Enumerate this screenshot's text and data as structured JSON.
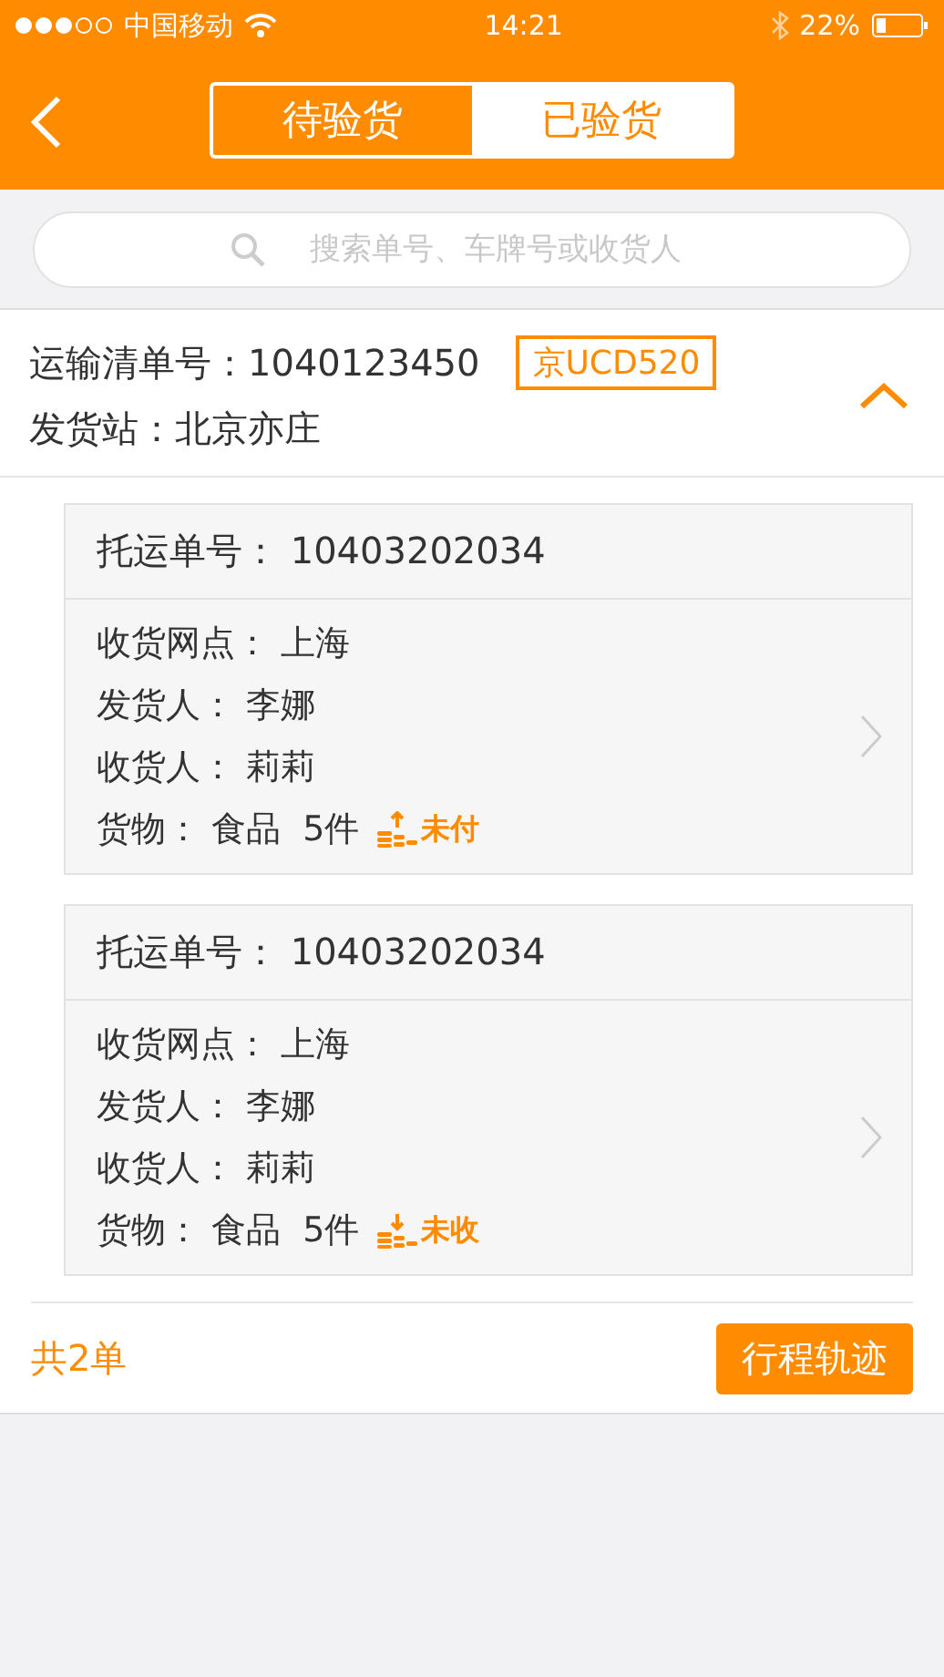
{
  "status_bar": {
    "carrier": "中国移动",
    "time": "14:21",
    "battery": "22%"
  },
  "tabs": [
    {
      "label": "待验货",
      "selected": false
    },
    {
      "label": "已验货",
      "selected": true
    }
  ],
  "search": {
    "placeholder": "搜索单号、车牌号或收货人"
  },
  "manifest": {
    "number_label": "运输清单号：",
    "number": "1040123450",
    "plate": "京UCD520",
    "station_label": "发货站：",
    "station": "北京亦庄",
    "expanded": true
  },
  "shipments": [
    {
      "title_label": "托运单号：",
      "title": "10403202034",
      "fields": [
        {
          "label": "收货网点：",
          "value": "上海"
        },
        {
          "label": "发货人：",
          "value": "李娜"
        },
        {
          "label": "收货人：",
          "value": "莉莉"
        }
      ],
      "goods_label": "货物：",
      "goods": "食品",
      "count": "5件",
      "payment": {
        "kind": "pay",
        "label": "未付"
      }
    },
    {
      "title_label": "托运单号：",
      "title": "10403202034",
      "fields": [
        {
          "label": "收货网点：",
          "value": "上海"
        },
        {
          "label": "发货人：",
          "value": "李娜"
        },
        {
          "label": "收货人：",
          "value": "莉莉"
        }
      ],
      "goods_label": "货物：",
      "goods": "食品",
      "count": "5件",
      "payment": {
        "kind": "receive",
        "label": "未收"
      }
    }
  ],
  "footer": {
    "total": "共2单",
    "button": "行程轨迹"
  }
}
